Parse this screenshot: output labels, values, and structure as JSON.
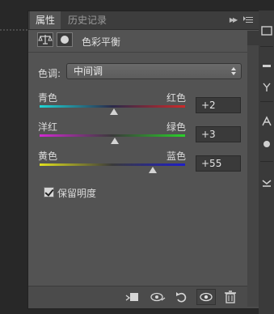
{
  "tabs": [
    {
      "label": "属性",
      "active": true
    },
    {
      "label": "历史记录",
      "active": false
    }
  ],
  "header": {
    "title": "色彩平衡",
    "icons": [
      "balance-scale-icon",
      "mask-icon"
    ]
  },
  "tone": {
    "label": "色调:",
    "selected": "中间调"
  },
  "sliders": [
    {
      "left_label": "青色",
      "right_label": "红色",
      "value": "+2",
      "fraction": 0.51
    },
    {
      "left_label": "洋红",
      "right_label": "绿色",
      "value": "+3",
      "fraction": 0.515
    },
    {
      "left_label": "黄色",
      "right_label": "蓝色",
      "value": "+55",
      "fraction": 0.775
    }
  ],
  "preserve_luminosity": {
    "label": "保留明度",
    "checked": true
  },
  "footer_icons": [
    "clip-to-layer-icon",
    "view-previous-state-icon",
    "reset-icon",
    "visibility-eye-icon",
    "delete-trash-icon"
  ],
  "colors": {
    "panel_bg": "#535353",
    "tab_bar_bg": "#3d3d3d",
    "cyan": "#1fd6d6",
    "red": "#cc2a2a",
    "magenta": "#d12ad1",
    "green": "#2ad12a",
    "yellow": "#e0e01e",
    "blue": "#1e1ec8"
  }
}
